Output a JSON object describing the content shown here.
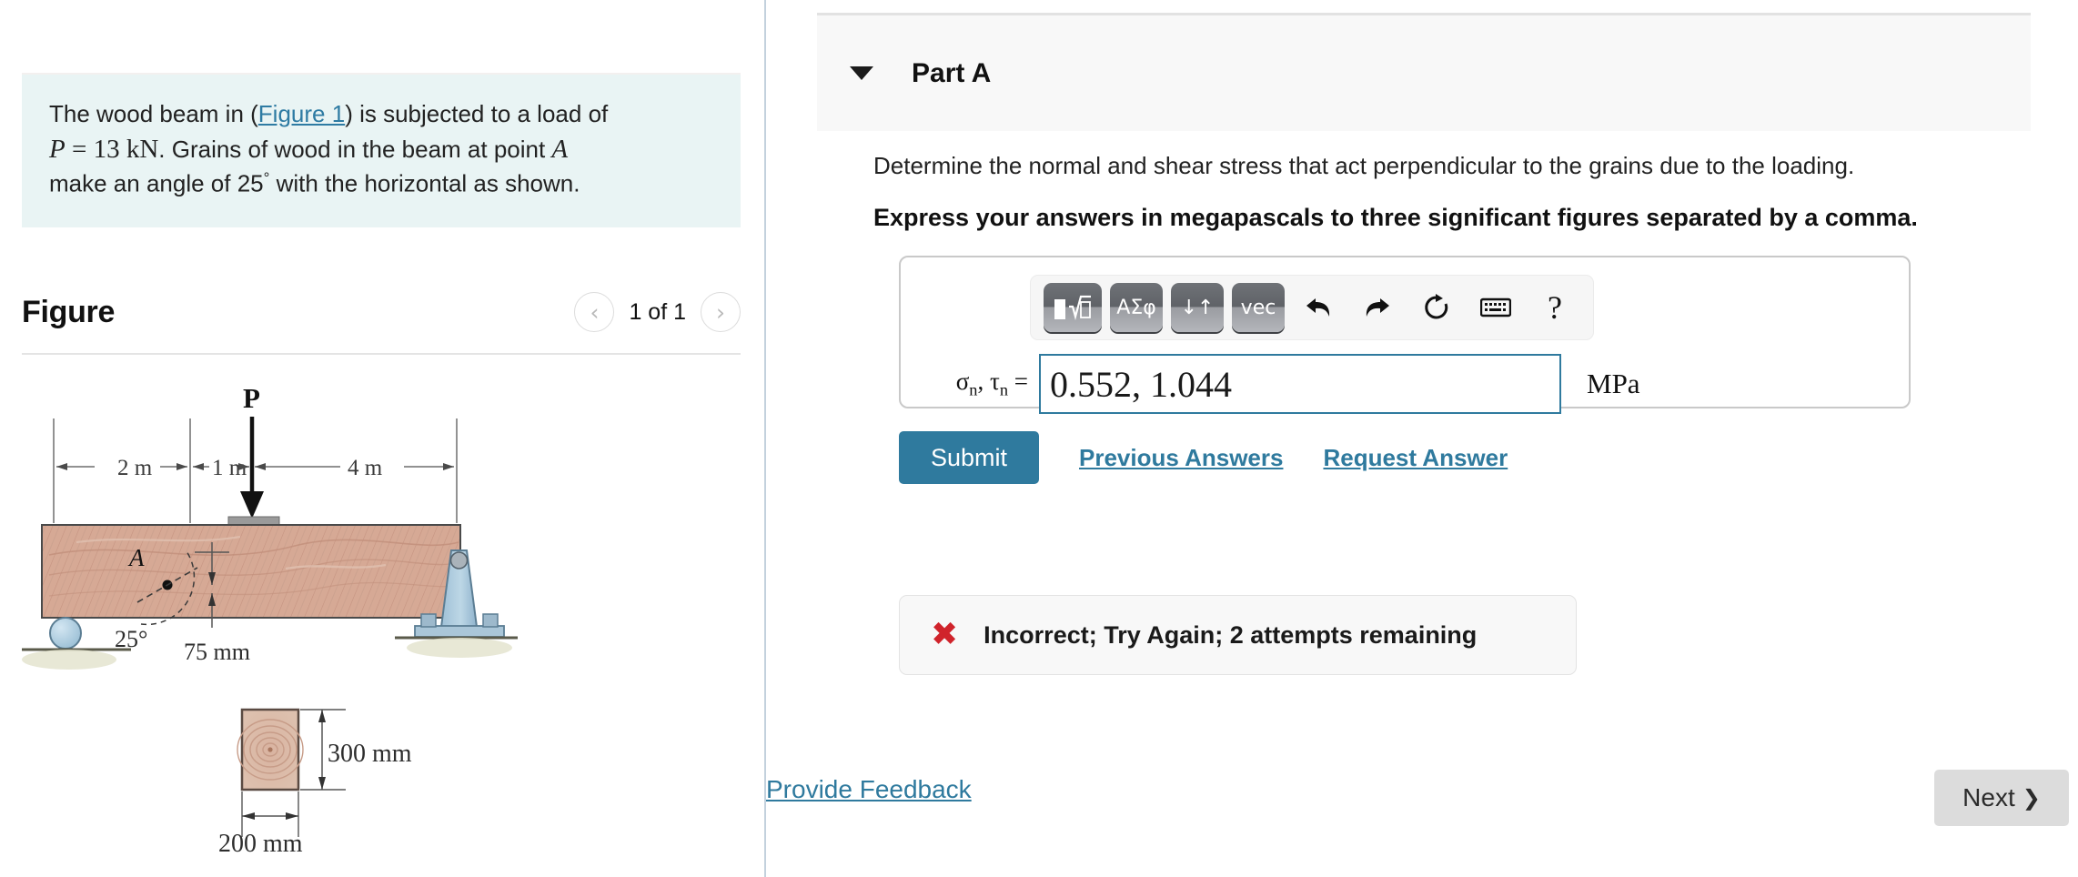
{
  "problem": {
    "line1_a": "The wood beam in (",
    "figure_link": "Figure 1",
    "line1_b": ") is subjected to a load of",
    "P_symbol": "P",
    "P_eq": " = 13 kN",
    "line2_b": ". Grains of wood in the beam at point ",
    "point_label": "A",
    "line3": "make an angle of 25",
    "degree": "°",
    "line3_b": " with the horizontal as shown."
  },
  "figure": {
    "title": "Figure",
    "prev_icon": "chevron-left-icon",
    "next_icon": "chevron-right-icon",
    "counter": "1 of 1",
    "diagram": {
      "load_label": "P",
      "dim_2m": "2 m",
      "dim_1m": "1 m",
      "dim_4m": "4 m",
      "point_label": "A",
      "angle_label": "25°",
      "depth_label": "75 mm",
      "section_height": "300 mm",
      "section_width": "200 mm",
      "wood_color": "#d6a995",
      "support_color": "#a8c6d9",
      "ground_color": "#e4e4cf"
    }
  },
  "part": {
    "caret_icon": "caret-down-icon",
    "label": "Part A",
    "question": "Determine the normal and shear stress that act perpendicular to the grains due to the loading.",
    "instruction": "Express your answers in megapascals to three significant figures separated by a comma."
  },
  "toolbar": {
    "buttons": [
      {
        "name": "template-math-button",
        "glyph": "math-template-icon"
      },
      {
        "name": "greek-symbols-button",
        "glyph": "ΑΣφ"
      },
      {
        "name": "updown-arrows-button",
        "glyph": "↓↑"
      },
      {
        "name": "vector-button",
        "glyph": "vec"
      }
    ],
    "undo_icon": "undo-arrow-icon",
    "redo_icon": "redo-arrow-icon",
    "reset_icon": "reset-circular-arrow-icon",
    "keyboard_icon": "keyboard-icon",
    "help_icon": "question-mark-icon"
  },
  "answer": {
    "label_sigma": "σ",
    "label_sigma_sub": "n",
    "label_sep": ", ",
    "label_tau": "τ",
    "label_tau_sub": "n",
    "label_eq": " =",
    "value": "0.552, 1.044",
    "placeholder": "",
    "units": "MPa",
    "input_border_color": "#2f7a9e"
  },
  "actions": {
    "submit_label": "Submit",
    "previous_answers_label": "Previous Answers",
    "request_answer_label": "Request Answer",
    "accent_color": "#2f7a9e"
  },
  "feedback": {
    "icon": "x-mark-icon",
    "message": "Incorrect; Try Again; 2 attempts remaining",
    "icon_color": "#d0232b"
  },
  "footer": {
    "provide_feedback_label": "Provide Feedback",
    "next_label": "Next",
    "next_icon": "chevron-right-icon"
  }
}
